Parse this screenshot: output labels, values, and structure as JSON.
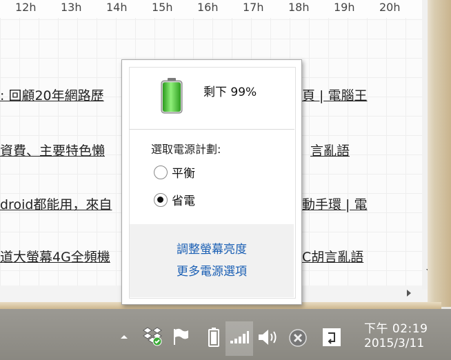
{
  "timeline": {
    "ticks": [
      "12h",
      "13h",
      "14h",
      "15h",
      "16h",
      "17h",
      "18h",
      "19h",
      "20h"
    ]
  },
  "document": {
    "lines": [
      {
        "left": ": 回顧20年網路歷",
        "right": "頁 | 電腦王"
      },
      {
        "left": "資費、主要特色懶",
        "right": "言亂語"
      },
      {
        "left": "droid都能用，來自",
        "right": "動手環 | 電"
      },
      {
        "left": "道大螢幕4G全頻機",
        "right": "C胡言亂語"
      }
    ]
  },
  "power_flyout": {
    "battery_status": "剩下 99%",
    "battery_level": 0.99,
    "plan_title": "選取電源計劃:",
    "plans": [
      {
        "label": "平衡",
        "selected": false
      },
      {
        "label": "省電",
        "selected": true
      }
    ],
    "links": [
      "調整螢幕亮度",
      "更多電源選項"
    ]
  },
  "taskbar": {
    "icons": [
      "show-hidden-icons-arrow",
      "dropbox-icon",
      "action-center-flag-icon",
      "battery-icon",
      "network-signal-icon",
      "volume-icon",
      "close-circle-icon",
      "input-method-icon"
    ],
    "time": "下午 02:19",
    "date": "2015/3/11"
  },
  "colors": {
    "link": "#1a5fb4",
    "taskbar": "#8f8d87",
    "battery_green": "#3cbf2a"
  }
}
